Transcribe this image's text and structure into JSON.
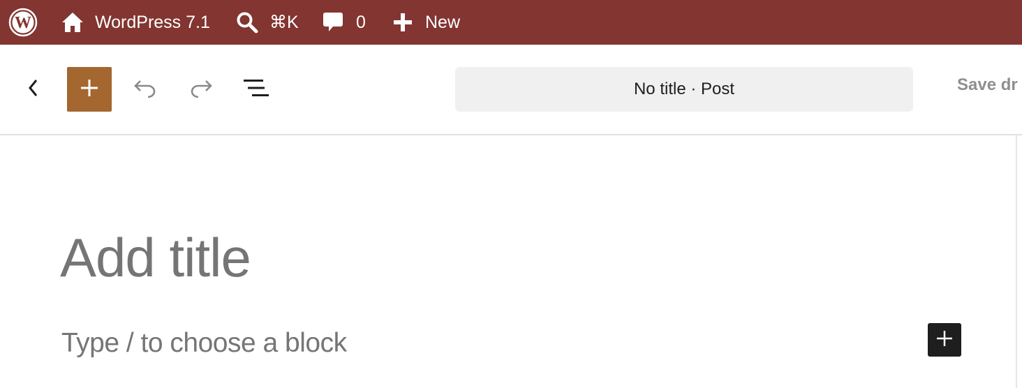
{
  "admin_bar": {
    "logo_icon": "wordpress-logo-icon",
    "site_name": "WordPress 7.1",
    "site_icon": "home-icon",
    "search_shortcut": "⌘K",
    "search_icon": "search-icon",
    "comments_count": "0",
    "comments_icon": "comment-bubble-icon",
    "new_label": "New",
    "new_icon": "plus-icon",
    "background_color": "#823531"
  },
  "editor_header": {
    "back_icon": "chevron-left-icon",
    "inserter_icon": "plus-icon",
    "inserter_color": "#a3672f",
    "undo_icon": "undo-icon",
    "redo_icon": "redo-icon",
    "list_view_icon": "list-view-icon",
    "document_bar_label": "No title · Post",
    "save_draft_label": "Save dr"
  },
  "canvas": {
    "title_placeholder": "Add title",
    "block_placeholder": "Type / to choose a block",
    "add_block_icon": "plus-icon"
  }
}
